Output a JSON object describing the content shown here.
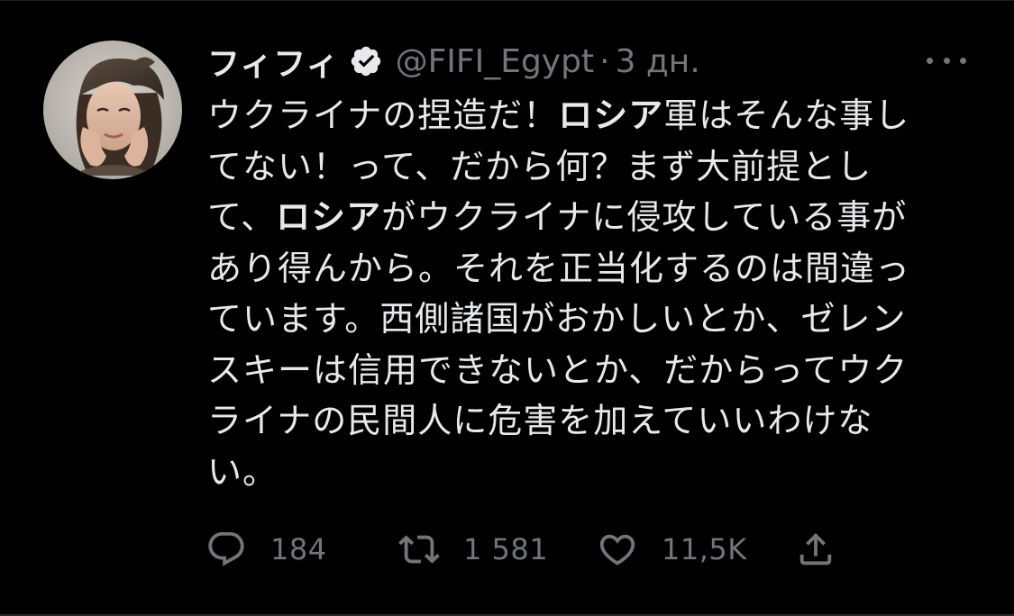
{
  "tweet": {
    "author": {
      "display_name": "フィフィ",
      "handle": "@FIFI_Egypt",
      "verified": true
    },
    "separator": "·",
    "time": "3 дн.",
    "body_lines": [
      {
        "plain1": "ウクライナの捏造だ！",
        "bold": "ロシア",
        "plain2": "軍はそんな事し"
      },
      {
        "plain1": "てない！って、だから何？まず大前提とし",
        "bold": "",
        "plain2": ""
      },
      {
        "plain1": "て、",
        "bold": "ロシア",
        "plain2": "がウクライナに侵攻している事が"
      },
      {
        "plain1": "あり得んから。それを正当化するのは間違っ",
        "bold": "",
        "plain2": ""
      },
      {
        "plain1": "ています。西側諸国がおかしいとか、ゼレン",
        "bold": "",
        "plain2": ""
      },
      {
        "plain1": "スキーは信用できないとか、だからってウク",
        "bold": "",
        "plain2": ""
      },
      {
        "plain1": "ライナの民間人に危害を加えていいわけな",
        "bold": "",
        "plain2": ""
      },
      {
        "plain1": "い。",
        "bold": "",
        "plain2": ""
      }
    ],
    "actions": {
      "reply_count": "184",
      "retweet_count": "1 581",
      "like_count": "11,5K"
    }
  },
  "icons": {
    "verified": "verified-badge-icon",
    "more": "more-dots-icon",
    "reply": "reply-icon",
    "retweet": "retweet-icon",
    "like": "heart-icon",
    "share": "share-icon"
  },
  "colors": {
    "background": "#000000",
    "text_primary": "#e7e9ea",
    "text_secondary": "#71767b"
  }
}
